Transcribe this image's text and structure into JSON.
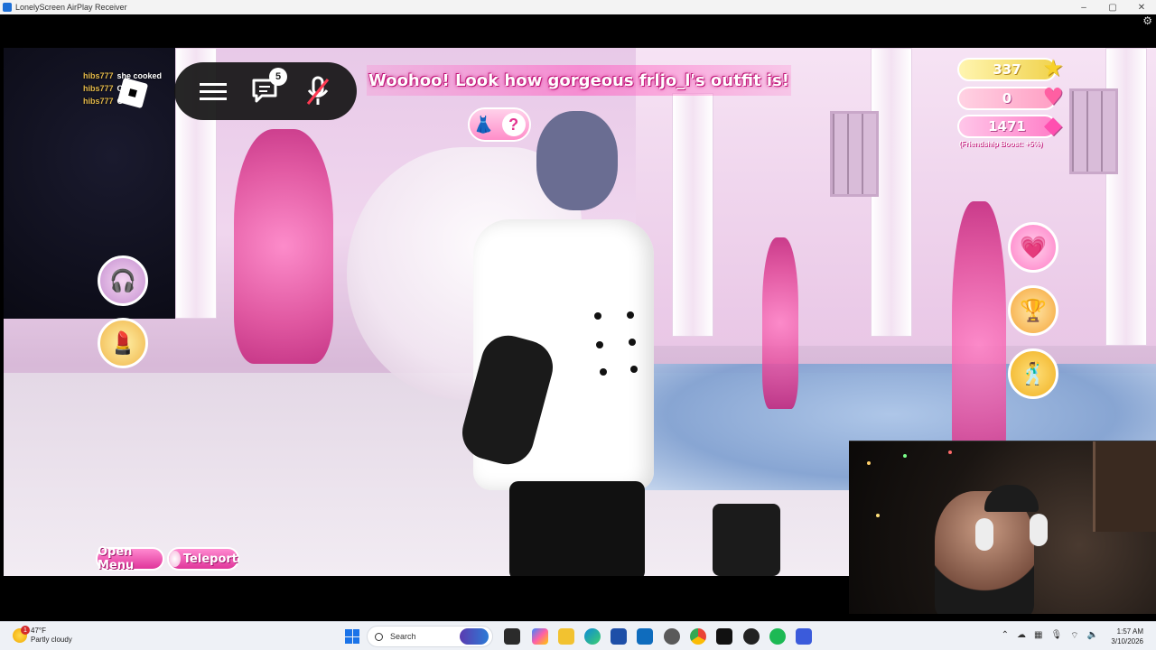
{
  "window": {
    "title": "LonelyScreen AirPlay Receiver",
    "controls": [
      "–",
      "▢",
      "✕"
    ]
  },
  "game": {
    "chat": [
      {
        "user": "hibs777",
        "message": "she cooked"
      },
      {
        "user": "hibs777",
        "message": "O"
      },
      {
        "user": "hibs777",
        "message": "O"
      }
    ],
    "chat_notifications": "5",
    "banner": "Woohoo! Look how gorgeous frljo_l's outfit is!",
    "stats": {
      "stars": "337",
      "hearts": "0",
      "gems": "1471",
      "boost": "(Friendship Boost: +5%)"
    },
    "buttons": {
      "open_menu": "Open Menu",
      "teleport": "Teleport"
    },
    "hint_symbol": "?"
  },
  "taskbar": {
    "weather_temp": "47°F",
    "weather_desc": "Partly cloudy",
    "weather_badge": "1",
    "search_placeholder": "Search",
    "time": "1:57 AM",
    "date": "3/10/2026"
  },
  "colors": {
    "accent_pink": "#e0359a",
    "banner_text": "#ffffff",
    "taskbar_bg": "#eef1f6",
    "windows_blue": "#1a73e8"
  }
}
